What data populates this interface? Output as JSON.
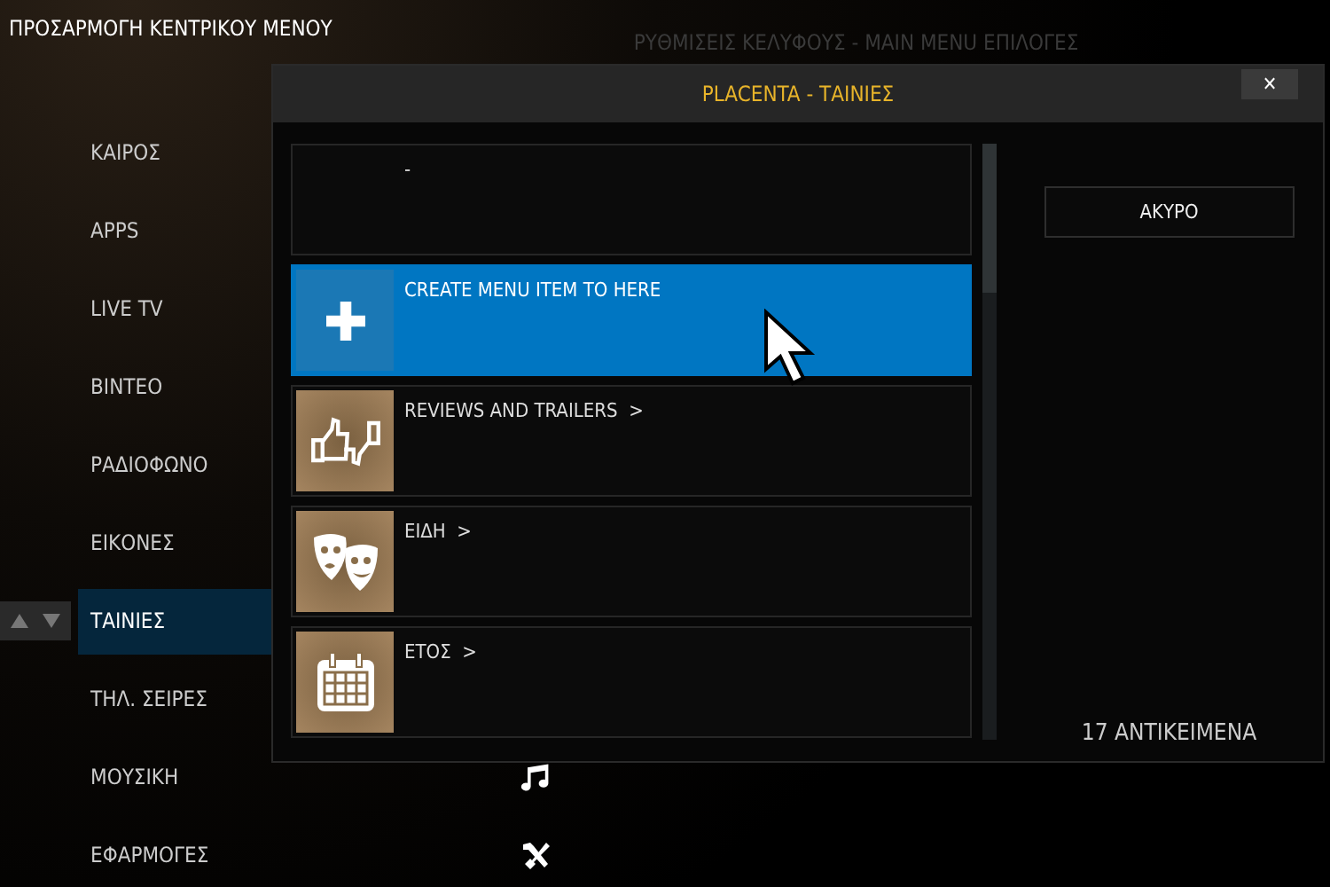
{
  "screen_title": "ΠΡΟΣΑΡΜΟΓΗ ΚΕΝΤΡΙΚΟΥ ΜΕΝΟΥ",
  "background_heading": "ΡΥΘΜΙΣΕΙΣ ΚΕΛΥΦΟΥΣ - MAIN MENU ΕΠΙΛΟΓΕΣ",
  "menu": [
    {
      "label": "ΚΑΙΡΟΣ",
      "selected": false,
      "kind": "plain"
    },
    {
      "label": "APPS",
      "selected": false,
      "kind": "plain"
    },
    {
      "label": "LIVE TV",
      "selected": false,
      "kind": "plain"
    },
    {
      "label": "ΒΙΝΤΕΟ",
      "selected": false,
      "kind": "plain"
    },
    {
      "label": "ΡΑΔΙΟΦΩΝΟ",
      "selected": false,
      "kind": "plain"
    },
    {
      "label": "ΕΙΚΟΝΕΣ",
      "selected": false,
      "kind": "plain"
    },
    {
      "label": "ΤΑΙΝΙΕΣ",
      "selected": true,
      "kind": "plain"
    },
    {
      "label": "ΤΗΛ. ΣΕΙΡΕΣ",
      "selected": false,
      "kind": "plain"
    },
    {
      "label": "ΜΟΥΣΙΚΗ",
      "selected": false,
      "kind": "music"
    },
    {
      "label": "ΕΦΑΡΜΟΓΕΣ",
      "selected": false,
      "kind": "tools"
    }
  ],
  "dialog": {
    "title": "PLACENTA - ΤΑΙΝΙΕΣ",
    "close": "✕",
    "items": [
      {
        "label": "-",
        "kind": "blank",
        "selected": false
      },
      {
        "label": "CREATE MENU ITEM TO HERE",
        "kind": "add",
        "selected": true
      },
      {
        "label": "REVIEWS AND TRAILERS  >",
        "kind": "thumbs",
        "selected": false
      },
      {
        "label": "ΕΙΔΗ  >",
        "kind": "masks",
        "selected": false
      },
      {
        "label": "ΕΤΟΣ  >",
        "kind": "calendar",
        "selected": false
      }
    ],
    "cancel_button": "ΑΚΥΡΟ",
    "item_count": "17 ΑΝΤΙΚΕΙΜΕΝΑ"
  }
}
